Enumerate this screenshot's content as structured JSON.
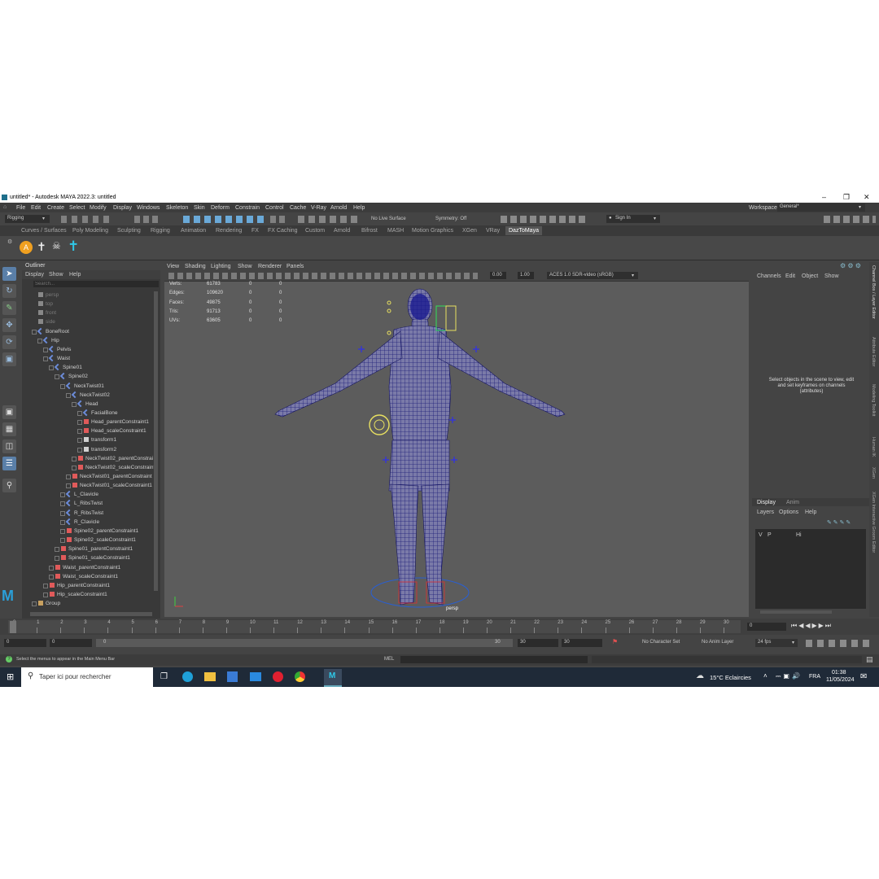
{
  "window": {
    "title": "untitled* - Autodesk MAYA 2022.3: untitled"
  },
  "menu": [
    "File",
    "Edit",
    "Create",
    "Select",
    "Modify",
    "Display",
    "Windows",
    "Skeleton",
    "Skin",
    "Deform",
    "Constrain",
    "Control",
    "Cache",
    "V-Ray",
    "Arnold",
    "Help"
  ],
  "workspace": {
    "label": "Workspace:",
    "value": "General*"
  },
  "status": {
    "mode": "Rigging",
    "live_surface": "No Live Surface",
    "symmetry": "Symmetry: Off",
    "sign_in": "Sign In"
  },
  "shelf_tabs": [
    "Curves / Surfaces",
    "Poly Modeling",
    "Sculpting",
    "Rigging",
    "Animation",
    "Rendering",
    "FX",
    "FX Caching",
    "Custom",
    "Arnold",
    "Bifrost",
    "MASH",
    "Motion Graphics",
    "XGen",
    "VRay",
    "DazToMaya"
  ],
  "outliner": {
    "title": "Outliner",
    "menu": [
      "Display",
      "Show",
      "Help"
    ],
    "search_placeholder": "Search...",
    "rows": [
      {
        "name": "persp",
        "depth": 0,
        "kind": "cam"
      },
      {
        "name": "top",
        "depth": 0,
        "kind": "cam"
      },
      {
        "name": "front",
        "depth": 0,
        "kind": "cam"
      },
      {
        "name": "side",
        "depth": 0,
        "kind": "cam"
      },
      {
        "name": "BoneRoot",
        "depth": 0,
        "kind": "joint"
      },
      {
        "name": "Hip",
        "depth": 1,
        "kind": "joint"
      },
      {
        "name": "Pelvis",
        "depth": 2,
        "kind": "joint"
      },
      {
        "name": "Waist",
        "depth": 2,
        "kind": "joint"
      },
      {
        "name": "Spine01",
        "depth": 3,
        "kind": "joint"
      },
      {
        "name": "Spine02",
        "depth": 4,
        "kind": "joint"
      },
      {
        "name": "NeckTwist01",
        "depth": 5,
        "kind": "joint"
      },
      {
        "name": "NeckTwist02",
        "depth": 6,
        "kind": "joint"
      },
      {
        "name": "Head",
        "depth": 7,
        "kind": "joint"
      },
      {
        "name": "FacialBone",
        "depth": 8,
        "kind": "joint"
      },
      {
        "name": "Head_parentConstraint1",
        "depth": 8,
        "kind": "con"
      },
      {
        "name": "Head_scaleConstraint1",
        "depth": 8,
        "kind": "con"
      },
      {
        "name": "transform1",
        "depth": 8,
        "kind": "xf"
      },
      {
        "name": "transform2",
        "depth": 8,
        "kind": "xf"
      },
      {
        "name": "NeckTwist02_parentConstrai",
        "depth": 7,
        "kind": "con"
      },
      {
        "name": "NeckTwist02_scaleConstraint",
        "depth": 7,
        "kind": "con"
      },
      {
        "name": "NeckTwist01_parentConstraint",
        "depth": 6,
        "kind": "con"
      },
      {
        "name": "NeckTwist01_scaleConstraint1",
        "depth": 6,
        "kind": "con"
      },
      {
        "name": "L_Clavicle",
        "depth": 5,
        "kind": "joint"
      },
      {
        "name": "L_RibsTwist",
        "depth": 5,
        "kind": "joint"
      },
      {
        "name": "R_RibsTwist",
        "depth": 5,
        "kind": "joint"
      },
      {
        "name": "R_Clavicle",
        "depth": 5,
        "kind": "joint"
      },
      {
        "name": "Spine02_parentConstraint1",
        "depth": 5,
        "kind": "con"
      },
      {
        "name": "Spine02_scaleConstraint1",
        "depth": 5,
        "kind": "con"
      },
      {
        "name": "Spine01_parentConstraint1",
        "depth": 4,
        "kind": "con"
      },
      {
        "name": "Spine01_scaleConstraint1",
        "depth": 4,
        "kind": "con"
      },
      {
        "name": "Waist_parentConstraint1",
        "depth": 3,
        "kind": "con"
      },
      {
        "name": "Waist_scaleConstraint1",
        "depth": 3,
        "kind": "con"
      },
      {
        "name": "Hip_parentConstraint1",
        "depth": 2,
        "kind": "con"
      },
      {
        "name": "Hip_scaleConstraint1",
        "depth": 2,
        "kind": "con"
      },
      {
        "name": "Group",
        "depth": 0,
        "kind": "grp"
      }
    ]
  },
  "viewport": {
    "menu": [
      "View",
      "Shading",
      "Lighting",
      "Show",
      "Renderer",
      "Panels"
    ],
    "exposure": "0.00",
    "gamma": "1.00",
    "colorspace": "ACES 1.0 SDR-video (sRGB)",
    "camera": "persp",
    "hud": [
      {
        "label": "Verts:",
        "v1": "61783",
        "v2": "0",
        "v3": "0"
      },
      {
        "label": "Edges:",
        "v1": "109620",
        "v2": "0",
        "v3": "0"
      },
      {
        "label": "Faces:",
        "v1": "49875",
        "v2": "0",
        "v3": "0"
      },
      {
        "label": "Tris:",
        "v1": "91713",
        "v2": "0",
        "v3": "0"
      },
      {
        "label": "UVs:",
        "v1": "63605",
        "v2": "0",
        "v3": "0"
      }
    ]
  },
  "channel_box": {
    "menu": [
      "Channels",
      "Edit",
      "Object",
      "Show"
    ],
    "hint": "Select objects in the scene to view, edit and set keyframes on channels (attributes)",
    "layer_tabs": [
      "Display",
      "Anim"
    ],
    "layer_menu": [
      "Layers",
      "Options",
      "Help"
    ],
    "layer_row": {
      "v": "V",
      "p": "P",
      "name": "Hi"
    }
  },
  "side_tabs": [
    "Channel Box / Layer Editor",
    "Attribute Editor",
    "Modeling Toolkit",
    "Human IK",
    "XGen",
    "XGen Interactive Groom Editor"
  ],
  "timeline": {
    "ticks": [
      "0",
      "1",
      "2",
      "3",
      "4",
      "5",
      "6",
      "7",
      "8",
      "9",
      "10",
      "11",
      "12",
      "13",
      "14",
      "15",
      "16",
      "17",
      "18",
      "19",
      "20",
      "21",
      "22",
      "23",
      "24",
      "25",
      "26",
      "27",
      "28",
      "29",
      "30"
    ],
    "current_frame": "0"
  },
  "range": {
    "start": "0",
    "inner_start": "0",
    "slider_start": "0",
    "slider_end": "30",
    "inner_end": "30",
    "end": "30",
    "character_set": "No Character Set",
    "anim_layer": "No Anim Layer",
    "fps": "24 fps"
  },
  "command": {
    "lang": "MEL",
    "help": "Select the menus to appear in the Main Menu Bar"
  },
  "taskbar": {
    "search_placeholder": "Taper ici pour rechercher",
    "weather": "15°C  Eclaircies",
    "lang": "FRA",
    "time": "01:38",
    "date": "11/05/2024"
  }
}
